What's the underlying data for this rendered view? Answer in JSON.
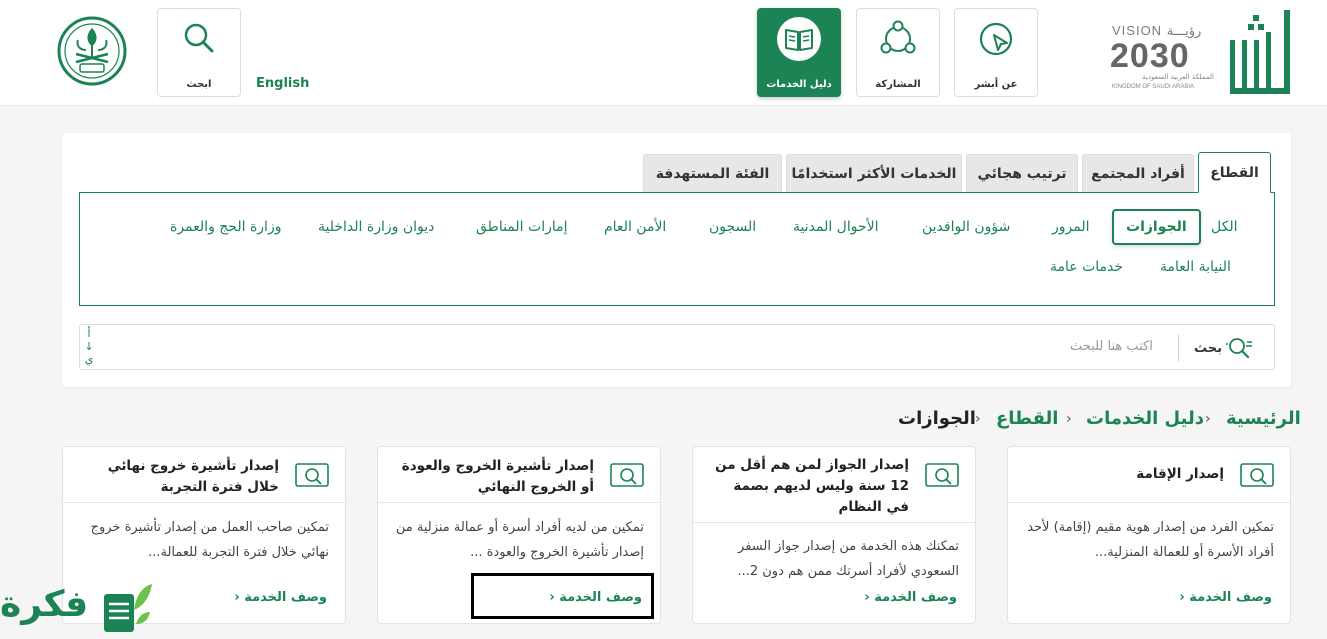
{
  "header": {
    "nav": [
      {
        "label": "عن أبشر",
        "icon": "pointer-icon"
      },
      {
        "label": "المشاركة",
        "icon": "share-network-icon"
      },
      {
        "label": "دليل الخدمات",
        "icon": "book-icon",
        "active": true
      }
    ],
    "search_label": "ابحث",
    "language_label": "English",
    "vision": {
      "top": "VISION",
      "top_ar": "رؤيـــة",
      "number": "2030",
      "country_ar": "المملكة العربية السعودية",
      "country_en": "KINGDOM OF SAUDI ARABIA"
    },
    "logo": "أبشر"
  },
  "tabs": [
    {
      "label": "القطاع",
      "active": true
    },
    {
      "label": "أفراد المجتمع"
    },
    {
      "label": "ترتيب هجائي"
    },
    {
      "label": "الخدمات الأكثر استخدامًا"
    },
    {
      "label": "الفئة المستهدفة"
    }
  ],
  "sectors": [
    "الكل",
    "الجوازات",
    "المرور",
    "شؤون الوافدين",
    "الأحوال المدنية",
    "السجون",
    "الأمن العام",
    "إمارات المناطق",
    "ديوان وزارة الداخلية",
    "وزارة الحج والعمرة",
    "النيابة العامة",
    "خدمات عامة"
  ],
  "active_sector": "الجوازات",
  "search": {
    "label": "بحث",
    "placeholder": "اكتب هنا للبحث",
    "sort_marks": [
      "أ",
      "↓",
      "ي"
    ]
  },
  "breadcrumb": [
    "الرئيسية",
    "دليل الخدمات",
    "القطاع",
    "الجوازات"
  ],
  "cards": [
    {
      "title": "إصدار الإقامة",
      "description": "تمكين الفرد من إصدار هوية مقيم (إقامة) لأحد أفراد الأسرة أو للعمالة المنزلية...",
      "link": "وصف الخدمة ‹"
    },
    {
      "title": "إصدار الجواز لمن هم أقل من 12 سنة وليس لديهم بصمة في النظام",
      "description": "تمكنك هذه الخدمة من إصدار جواز السفر السعودي لأفراد أسرتك ممن هم دون 2...",
      "link": "وصف الخدمة ‹"
    },
    {
      "title": "إصدار تأشيرة الخروج والعودة أو الخروج النهائي",
      "description": "تمكين من لديه أفراد أسرة أو عمالة منزلية من إصدار تأشيرة الخروج والعودة ...",
      "link": "وصف الخدمة ‹"
    },
    {
      "title": "إصدار تأشيرة خروج نهائي خلال فترة التجربة",
      "description": "تمكين صاحب العمل من إصدار تأشيرة خروج نهائي خلال فترة التجربة للعمالة...",
      "link": "وصف الخدمة ‹"
    }
  ],
  "watermark": "فكرة",
  "colors": {
    "brand": "#1b8354",
    "background": "#f5f5f5"
  }
}
